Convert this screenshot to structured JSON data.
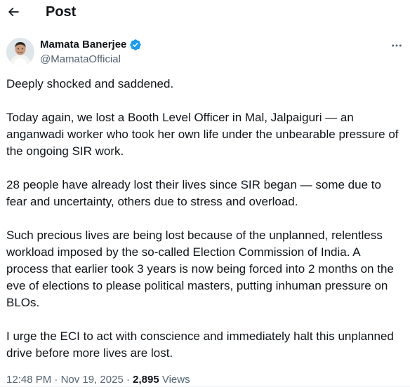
{
  "header": {
    "title": "Post"
  },
  "author": {
    "name": "Mamata Banerjee",
    "handle": "@MamataOfficial",
    "verified": true
  },
  "post": {
    "paragraphs": [
      "Deeply shocked and saddened.",
      "Today again, we lost a Booth Level Officer in Mal, Jalpaiguri — an anganwadi worker who took her own life under the unbearable pressure of the ongoing SIR work.",
      "28 people have already lost their lives since SIR began — some due to fear and uncertainty, others due to stress and overload.",
      "Such precious lives are being lost because of the unplanned, relentless workload imposed by the so-called Election Commission of India. A process that earlier took 3 years is now being forced into 2 months on the eve of elections to please political masters, putting inhuman pressure on BLOs.",
      "I urge the ECI to act with conscience and immediately halt this unplanned drive before more lives are lost."
    ]
  },
  "meta": {
    "time": "12:48 PM",
    "date": "Nov 19, 2025",
    "separator": " · ",
    "views_count": "2,895",
    "views_label": "Views"
  },
  "icons": {
    "back": "arrow-left-icon",
    "verified": "verified-badge-icon",
    "more": "more-horizontal-icon"
  },
  "colors": {
    "text": "#0f1419",
    "secondary": "#536471",
    "verified": "#1d9bf0"
  }
}
